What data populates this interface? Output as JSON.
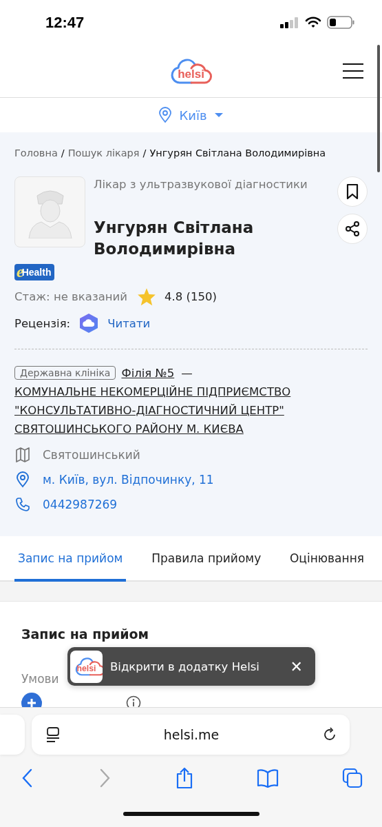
{
  "status_bar": {
    "time": "12:47"
  },
  "header": {
    "logo_text": "helsi"
  },
  "city": {
    "label": "Київ"
  },
  "breadcrumbs": {
    "separator": "/",
    "items": [
      {
        "label": "Головна",
        "current": false
      },
      {
        "label": "Пошук лікаря",
        "current": false
      },
      {
        "label": "Унгурян Світлана Володимирівна",
        "current": true
      }
    ]
  },
  "doctor": {
    "specialty": "Лікар з ультразвукової діагностики",
    "name": "Унгурян Світлана Володимирівна",
    "badge_mark": "e",
    "badge_text": "Health",
    "experience": "Стаж: не вказаний",
    "rating": "4.8 (150)",
    "review_label": "Рецензія:",
    "review_link": "Читати"
  },
  "clinic": {
    "tag": "Державна клініка",
    "branch": "Філія №5",
    "dash": "—",
    "name": "КОМУНАЛЬНЕ НЕКОМЕРЦІЙНЕ ПІДПРИЄМСТВО \"КОНСУЛЬТАТИВНО-ДІАГНОСТИЧНИЙ ЦЕНТР\" СВЯТОШИНСЬКОГО РАЙОНУ М. КИЄВА",
    "details": [
      {
        "kind": "district",
        "text": "Святошинський"
      },
      {
        "kind": "address",
        "text": "м. Київ, вул. Відпочинку, 11"
      },
      {
        "kind": "phone",
        "text": "0442987269"
      }
    ]
  },
  "tabs": [
    {
      "label": "Запис на прийом",
      "selected": true
    },
    {
      "label": "Правила прийому",
      "selected": false
    },
    {
      "label": "Оцінювання",
      "selected": false
    }
  ],
  "appointment": {
    "title": "Запис на прийом",
    "conditions_label": "Умови"
  },
  "app_banner": {
    "logo_text": "helsi",
    "text": "Відкрити в додатку Helsi",
    "close": "✕"
  },
  "browser": {
    "url": "helsi.me"
  }
}
